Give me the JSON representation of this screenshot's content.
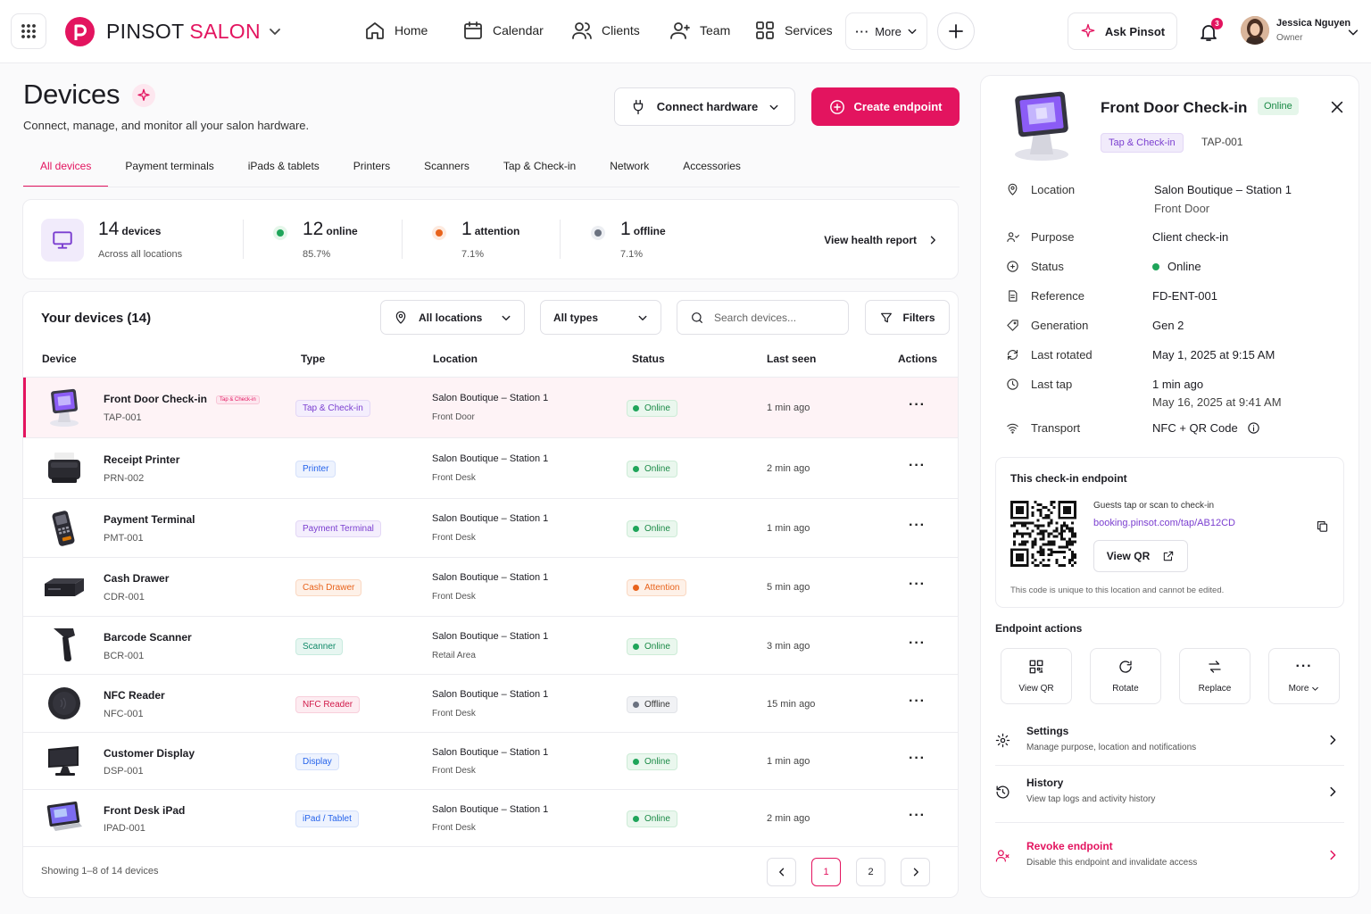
{
  "brand": {
    "name_a": "PINSOT",
    "name_b": "SALON",
    "logo_letter": "p"
  },
  "colors": {
    "accent": "#e3145f",
    "purple": "#7b3fd0",
    "online": "#1a8a46",
    "attention": "#e8631c",
    "offline": "#6b7280"
  },
  "nav": {
    "items": [
      {
        "label": "Home",
        "icon": "home-icon"
      },
      {
        "label": "Calendar",
        "icon": "calendar-icon"
      },
      {
        "label": "Clients",
        "icon": "clients-icon"
      },
      {
        "label": "Team",
        "icon": "team-icon"
      },
      {
        "label": "Services",
        "icon": "services-icon"
      }
    ],
    "more": "More",
    "ask": "Ask Pinsot",
    "notifications": "3",
    "user_name": "Jessica Nguyen",
    "user_role": "Owner"
  },
  "page": {
    "title": "Devices",
    "subtitle": "Connect, manage, and monitor all your salon hardware.",
    "connect_label": "Connect hardware",
    "create_label": "Create endpoint"
  },
  "tabs": [
    "All devices",
    "Payment terminals",
    "iPads & tablets",
    "Printers",
    "Scanners",
    "Tap & Check-in",
    "Network",
    "Accessories"
  ],
  "stats": {
    "total": "14",
    "total_label": "devices",
    "total_sub": "Across all locations",
    "online": "12",
    "online_label": "online",
    "online_pct": "85.7%",
    "attention": "1",
    "attention_label": "attention",
    "attention_pct": "7.1%",
    "offline": "1",
    "offline_label": "offline",
    "offline_pct": "7.1%",
    "health_link": "View health report"
  },
  "table": {
    "title": "Your devices (14)",
    "filter_location": "All locations",
    "filter_type": "All types",
    "search_placeholder": "Search devices...",
    "filters_label": "Filters",
    "headers": [
      "Device",
      "Type",
      "Location",
      "Status",
      "Last seen",
      "Actions"
    ],
    "rows": [
      {
        "name": "Front Door Check-in",
        "tag": "Tap & Check-in",
        "code": "TAP-001",
        "type": "Tap & Check-in",
        "loc": "Salon Boutique – Station 1",
        "area": "Front Door",
        "status": "Online",
        "seen": "1 min ago"
      },
      {
        "name": "Receipt Printer",
        "code": "PRN-002",
        "type": "Printer",
        "loc": "Salon Boutique – Station 1",
        "area": "Front Desk",
        "status": "Online",
        "seen": "2 min ago"
      },
      {
        "name": "Payment Terminal",
        "code": "PMT-001",
        "type": "Payment Terminal",
        "loc": "Salon Boutique – Station 1",
        "area": "Front Desk",
        "status": "Online",
        "seen": "1 min ago"
      },
      {
        "name": "Cash Drawer",
        "code": "CDR-001",
        "type": "Cash Drawer",
        "loc": "Salon Boutique – Station 1",
        "area": "Front Desk",
        "status": "Attention",
        "seen": "5 min ago"
      },
      {
        "name": "Barcode Scanner",
        "code": "BCR-001",
        "type": "Scanner",
        "loc": "Salon Boutique – Station 1",
        "area": "Retail Area",
        "status": "Online",
        "seen": "3 min ago"
      },
      {
        "name": "NFC Reader",
        "code": "NFC-001",
        "type": "NFC Reader",
        "loc": "Salon Boutique – Station 1",
        "area": "Front Desk",
        "status": "Offline",
        "seen": "15 min ago"
      },
      {
        "name": "Customer Display",
        "code": "DSP-001",
        "type": "Display",
        "loc": "Salon Boutique – Station 1",
        "area": "Front Desk",
        "status": "Online",
        "seen": "1 min ago"
      },
      {
        "name": "Front Desk iPad",
        "code": "IPAD-001",
        "type": "iPad / Tablet",
        "loc": "Salon Boutique – Station 1",
        "area": "Front Desk",
        "status": "Online",
        "seen": "2 min ago"
      }
    ],
    "footer": "Showing 1–8 of 14 devices",
    "pages": [
      "1",
      "2"
    ]
  },
  "detail": {
    "title": "Front Door Check-in",
    "status_pill": "Online",
    "tag": "Tap & Check-in",
    "code": "TAP-001",
    "props": [
      {
        "label": "Location",
        "value": "Salon Boutique – Station 1",
        "value2": "Front Door"
      },
      {
        "label": "Purpose",
        "value": "Client check-in"
      },
      {
        "label": "Status",
        "value": "Online"
      },
      {
        "label": "Reference",
        "value": "FD-ENT-001"
      },
      {
        "label": "Generation",
        "value": "Gen 2"
      },
      {
        "label": "Last rotated",
        "value": "May 1, 2025 at 9:15 AM"
      },
      {
        "label": "Last tap",
        "value": "1 min ago",
        "value2": "May 16, 2025 at 9:41 AM"
      },
      {
        "label": "Transport",
        "value": "NFC + QR Code"
      }
    ],
    "qr": {
      "title": "This check-in endpoint",
      "line1": "Guests tap or scan to check-in",
      "link": "booking.pinsot.com/tap/AB12CD",
      "view": "View QR",
      "note": "This code is unique to this location and cannot be edited."
    },
    "actions_title": "Endpoint actions",
    "actions": [
      "View QR",
      "Rotate",
      "Replace",
      "More"
    ],
    "settings": {
      "title": "Settings",
      "sub": "Manage purpose, location and notifications"
    },
    "history": {
      "title": "History",
      "sub": "View tap logs and activity history"
    },
    "revoke": {
      "title": "Revoke endpoint",
      "sub": "Disable this endpoint and invalidate access"
    }
  }
}
